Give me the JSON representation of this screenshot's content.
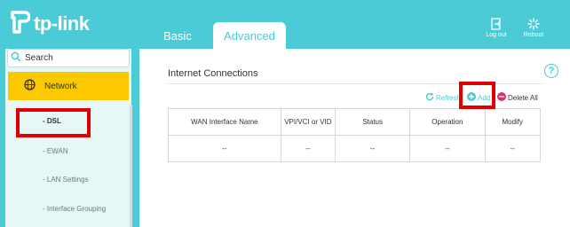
{
  "brand": {
    "name": "tp-link"
  },
  "tabs": {
    "basic": "Basic",
    "advanced": "Advanced"
  },
  "header_buttons": {
    "logout": "Log out",
    "reboot": "Reboot"
  },
  "sidebar": {
    "search_placeholder": "Search",
    "section": "Network",
    "items": [
      "- DSL",
      "- EWAN",
      "- LAN Settings",
      "- Interface Grouping"
    ]
  },
  "main": {
    "title": "Internet Connections",
    "help": "?",
    "actions": {
      "refresh": "Refresh",
      "add": "Add",
      "delete_all": "Delete All"
    },
    "table": {
      "columns": [
        "WAN Interface Name",
        "VPI/VCI or VID",
        "Status",
        "Operation",
        "Modify"
      ],
      "rows": [
        [
          "--",
          "--",
          "--",
          "--",
          "--"
        ]
      ]
    }
  },
  "colors": {
    "accent": "#4acbd6",
    "active_menu": "#fcc900",
    "highlight": "#e00000",
    "delete": "#e0306a"
  }
}
